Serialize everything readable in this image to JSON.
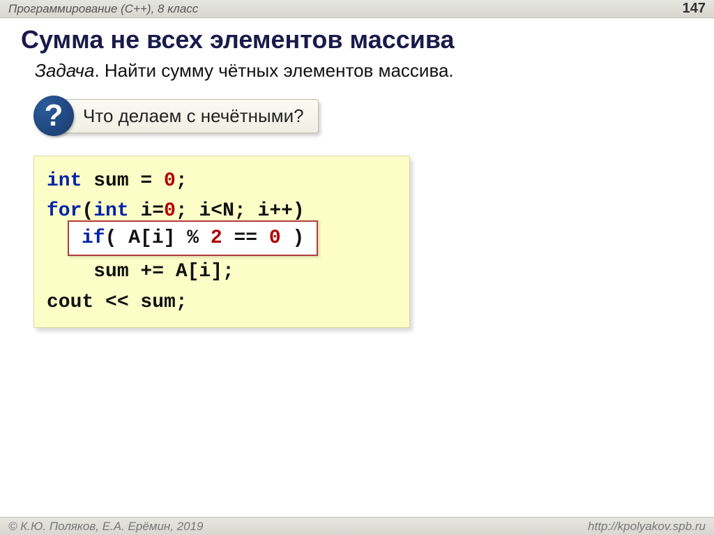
{
  "header": {
    "left": "Программирование (C++), 8 класс",
    "page": "147"
  },
  "title": "Сумма не всех элементов массива",
  "task": {
    "label": "Задача",
    "text": ". Найти сумму чётных элементов массива."
  },
  "callout": {
    "badge": "?",
    "text": " Что делаем с нечётными?"
  },
  "code": {
    "l1_kw": "int",
    "l1_rest": " sum = ",
    "l1_zero": "0",
    "l1_semi": ";",
    "l2_for": "for",
    "l2_open": "(",
    "l2_int": "int",
    "l2_mid1": " i=",
    "l2_zero": "0",
    "l2_mid2": "; i<N; i++)",
    "l_if_kw": "if",
    "l_if_body1": "( A[i] % ",
    "l_if_two": "2",
    "l_if_eq": " == ",
    "l_if_zero": "0",
    "l_if_close": " )",
    "l3_sum": "    sum += A[i];",
    "l4_cout": "cout << sum;"
  },
  "footer": {
    "left": "© К.Ю. Поляков, Е.А. Ерёмин, 2019",
    "right": "http://kpolyakov.spb.ru"
  }
}
